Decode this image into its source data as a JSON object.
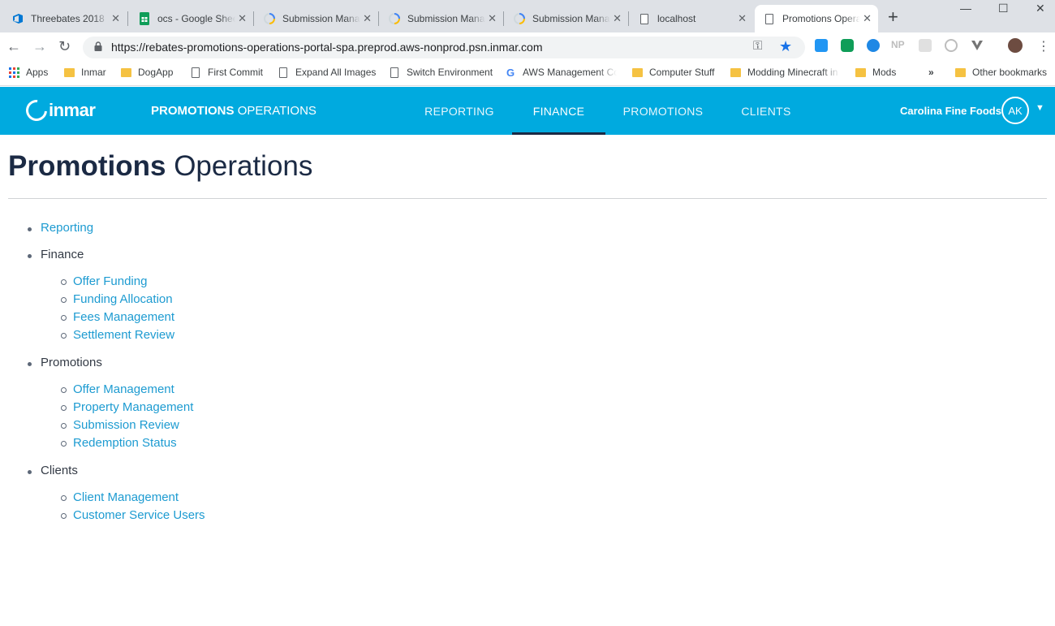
{
  "browser": {
    "tabs": [
      {
        "title": "Threebates 2018",
        "icon": "azure-devops-icon",
        "active": false
      },
      {
        "title": "ocs - Google Sheets",
        "icon": "google-sheets-icon",
        "active": false
      },
      {
        "title": "Submission Manager",
        "icon": "loading-spinner-icon",
        "active": false
      },
      {
        "title": "Submission Manager",
        "icon": "loading-spinner-icon",
        "active": false
      },
      {
        "title": "Submission Manager",
        "icon": "loading-spinner-icon",
        "active": false
      },
      {
        "title": "localhost",
        "icon": "page-icon",
        "active": false
      },
      {
        "title": "Promotions Operations",
        "icon": "page-icon",
        "active": true
      }
    ],
    "url": "https://rebates-promotions-operations-portal-spa.preprod.aws-nonprod.psn.inmar.com",
    "bookmarks": [
      {
        "label": "Apps",
        "icon": "apps-grid-icon"
      },
      {
        "label": "Inmar",
        "icon": "folder-icon"
      },
      {
        "label": "DogApp",
        "icon": "folder-icon"
      },
      {
        "label": "First Commit",
        "icon": "page-icon"
      },
      {
        "label": "Expand All Images",
        "icon": "page-icon"
      },
      {
        "label": "Switch Environment",
        "icon": "page-icon"
      },
      {
        "label": "AWS Management Console",
        "icon": "google-icon"
      },
      {
        "label": "Computer Stuff",
        "icon": "folder-icon"
      },
      {
        "label": "Modding Minecraft in",
        "icon": "folder-icon"
      },
      {
        "label": "Mods",
        "icon": "folder-icon"
      },
      {
        "label": "»",
        "icon": ""
      },
      {
        "label": "Other bookmarks",
        "icon": "folder-icon"
      }
    ],
    "extensions": [
      "NP"
    ]
  },
  "header": {
    "logo_text": "inmar",
    "app_title_bold": "PROMOTIONS",
    "app_title_light": "OPERATIONS",
    "nav": [
      {
        "label": "REPORTING",
        "active": false
      },
      {
        "label": "FINANCE",
        "active": true
      },
      {
        "label": "PROMOTIONS",
        "active": false
      },
      {
        "label": "CLIENTS",
        "active": false
      }
    ],
    "client_name": "Carolina Fine Foods",
    "avatar_initials": "AK",
    "brand_color": "#00aadf"
  },
  "page": {
    "title_bold": "Promotions",
    "title_light": "Operations",
    "menu": {
      "reporting": "Reporting",
      "finance": {
        "label": "Finance",
        "items": [
          "Offer Funding",
          "Funding Allocation",
          "Fees Management",
          "Settlement Review"
        ]
      },
      "promotions": {
        "label": "Promotions",
        "items": [
          "Offer Management",
          "Property Management",
          "Submission Review",
          "Redemption Status"
        ]
      },
      "clients": {
        "label": "Clients",
        "items": [
          "Client Management",
          "Customer Service Users"
        ]
      }
    }
  }
}
